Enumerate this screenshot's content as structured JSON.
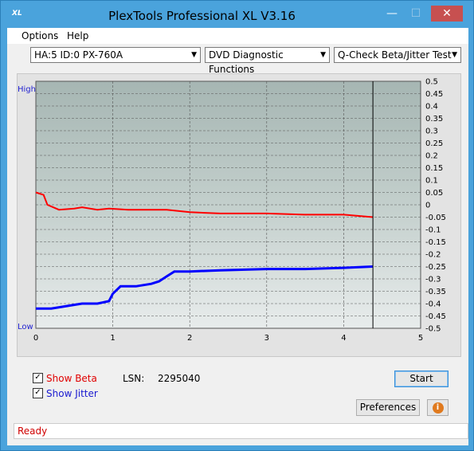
{
  "window": {
    "title": "PlexTools Professional XL V3.16",
    "icon_text": "XL",
    "minimize_glyph": "—",
    "maximize_glyph": "☐",
    "close_glyph": "✕"
  },
  "menu": {
    "options_label": "Options",
    "help_label": "Help"
  },
  "toolbar": {
    "drive_select": "HA:5 ID:0  PX-760A",
    "function_select": "DVD Diagnostic Functions",
    "test_select": "Q-Check Beta/Jitter Test"
  },
  "graph": {
    "high_label": "High",
    "low_label": "Low",
    "x_ticks": [
      "0",
      "1",
      "2",
      "3",
      "4",
      "5"
    ],
    "y_ticks": [
      "0.5",
      "0.45",
      "0.4",
      "0.35",
      "0.3",
      "0.25",
      "0.2",
      "0.15",
      "0.1",
      "0.05",
      "0",
      "-0.05",
      "-0.1",
      "-0.15",
      "-0.2",
      "-0.25",
      "-0.3",
      "-0.35",
      "-0.4",
      "-0.45",
      "-0.5"
    ],
    "beta_color": "#ff0000",
    "jitter_color": "#0000ff",
    "end_marker_x": 4.38
  },
  "chart_data": {
    "type": "line",
    "xlim": [
      0,
      5
    ],
    "ylim": [
      -0.5,
      0.5
    ],
    "series": [
      {
        "name": "Beta",
        "x": [
          0,
          0.1,
          0.15,
          0.3,
          0.5,
          0.6,
          0.8,
          0.95,
          1.2,
          1.4,
          1.7,
          2.0,
          2.4,
          3.0,
          3.5,
          4.0,
          4.38
        ],
        "values": [
          0.05,
          0.04,
          0.0,
          -0.02,
          -0.015,
          -0.01,
          -0.02,
          -0.015,
          -0.02,
          -0.02,
          -0.02,
          -0.03,
          -0.035,
          -0.035,
          -0.04,
          -0.04,
          -0.05
        ]
      },
      {
        "name": "Jitter",
        "x": [
          0,
          0.2,
          0.4,
          0.6,
          0.8,
          0.95,
          1.0,
          1.1,
          1.3,
          1.5,
          1.6,
          1.7,
          1.8,
          2.0,
          2.4,
          3.0,
          3.5,
          4.0,
          4.38
        ],
        "values": [
          -0.42,
          -0.42,
          -0.41,
          -0.4,
          -0.4,
          -0.39,
          -0.36,
          -0.33,
          -0.33,
          -0.32,
          -0.31,
          -0.29,
          -0.27,
          -0.27,
          -0.265,
          -0.26,
          -0.26,
          -0.255,
          -0.25
        ]
      }
    ]
  },
  "options": {
    "show_beta_label": "Show Beta",
    "show_jitter_label": "Show Jitter",
    "lsn_label": "LSN:",
    "lsn_value": "2295040",
    "checkmark": "✓"
  },
  "buttons": {
    "start_label": "Start",
    "preferences_label": "Preferences",
    "info_glyph": "i"
  },
  "status": {
    "text": "Ready"
  }
}
